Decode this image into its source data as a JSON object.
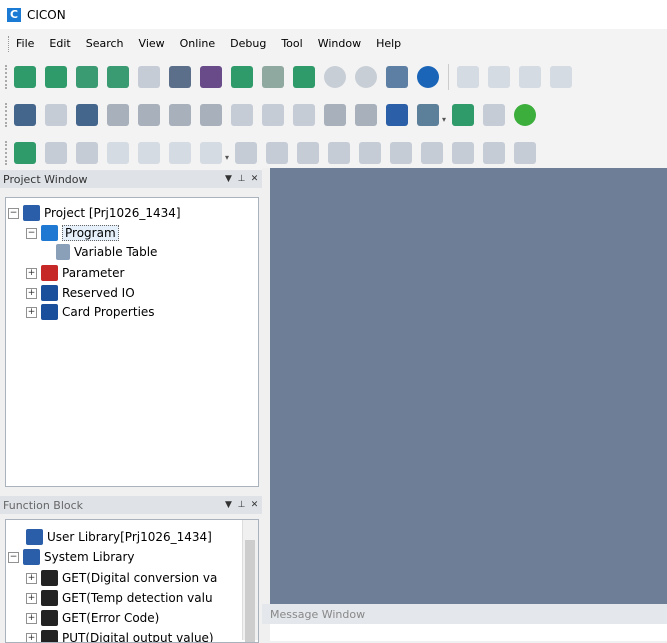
{
  "window": {
    "title": "CICON",
    "logo_letter": "C"
  },
  "menu": [
    "File",
    "Edit",
    "Search",
    "View",
    "Online",
    "Debug",
    "Tool",
    "Window",
    "Help"
  ],
  "project_window": {
    "title": "Project Window",
    "root": "Project [Prj1026_1434]",
    "program": "Program",
    "variable_table": "Variable Table",
    "parameter": "Parameter",
    "reserved_io": "Reserved IO",
    "card_properties": "Card Properties"
  },
  "function_block": {
    "title": "Function Block",
    "user_library": "User Library[Prj1026_1434]",
    "system_library": "System Library",
    "items": [
      "GET(Digital conversion va",
      "GET(Temp detection valu",
      "GET(Error Code)",
      "PUT(Digital output value)"
    ]
  },
  "message_window": {
    "title": "Message Window"
  },
  "colors": {
    "workspace": "#6e7e96",
    "accent": "#1a7ad4"
  }
}
